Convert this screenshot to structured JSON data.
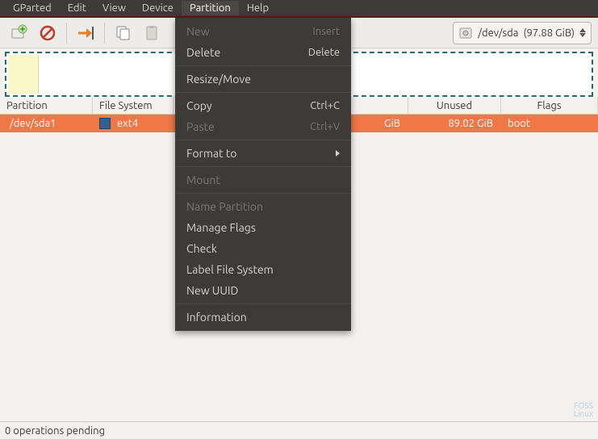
{
  "menubar": {
    "items": [
      "GParted",
      "Edit",
      "View",
      "Device",
      "Partition",
      "Help"
    ],
    "active": "Partition"
  },
  "device": {
    "path": "/dev/sda",
    "size": "(97.88 GiB)"
  },
  "table": {
    "headers": {
      "partition": "Partition",
      "fs": "File System",
      "unused": "Unused",
      "flags": "Flags"
    },
    "row": {
      "partition": "/dev/sda1",
      "fs": "ext4",
      "size_visible": "GiB",
      "unused": "89.02 GiB",
      "flags": "boot"
    }
  },
  "dropdown": {
    "new": {
      "label": "New",
      "accel": "Insert"
    },
    "delete": {
      "label": "Delete",
      "accel": "Delete"
    },
    "resize": {
      "label": "Resize/Move"
    },
    "copy": {
      "label": "Copy",
      "accel": "Ctrl+C"
    },
    "paste": {
      "label": "Paste",
      "accel": "Ctrl+V"
    },
    "format": {
      "label": "Format to"
    },
    "mount": {
      "label": "Mount"
    },
    "name": {
      "label": "Name Partition"
    },
    "flags": {
      "label": "Manage Flags"
    },
    "check": {
      "label": "Check"
    },
    "labelfs": {
      "label": "Label File System"
    },
    "uuid": {
      "label": "New UUID"
    },
    "info": {
      "label": "Information"
    }
  },
  "statusbar": {
    "text": "0 operations pending"
  },
  "watermark": {
    "line1": "FOSS",
    "line2": "Linux"
  }
}
